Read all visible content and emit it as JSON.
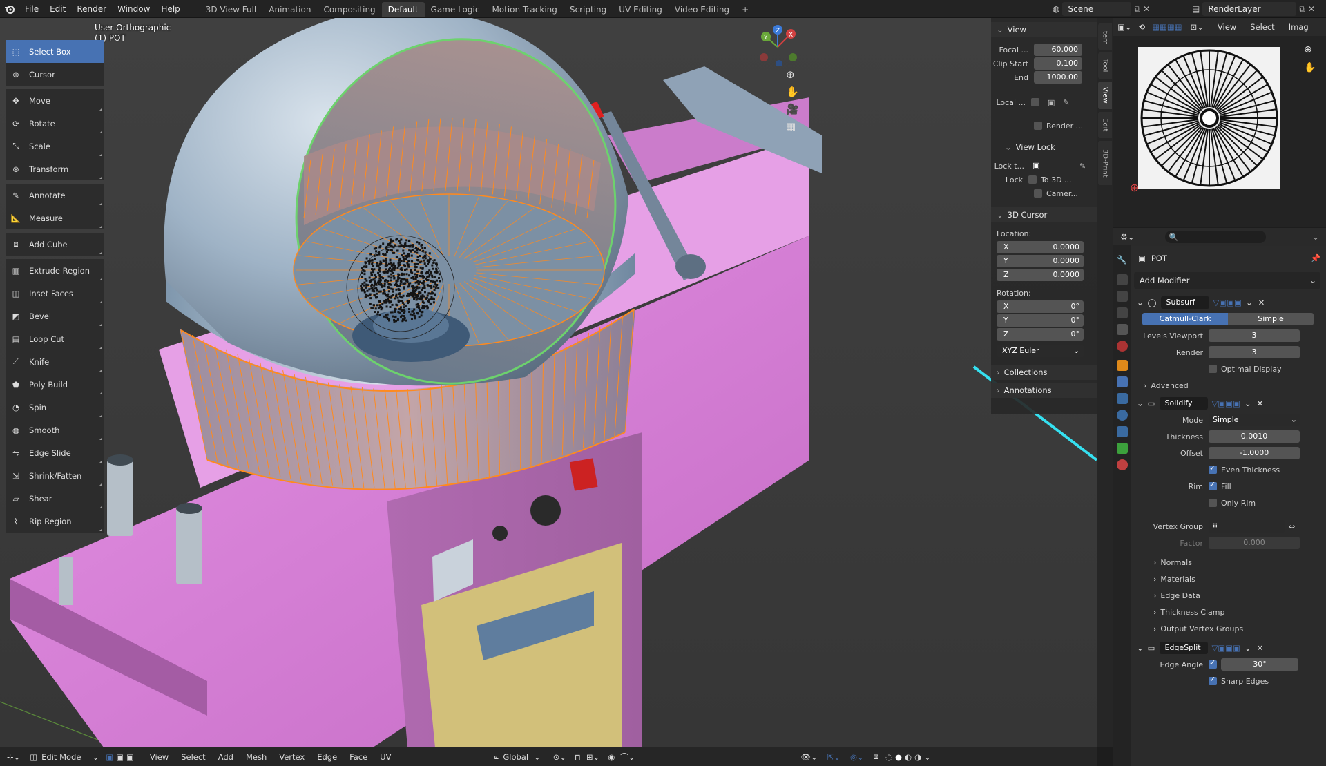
{
  "topbar": {
    "menus": [
      "File",
      "Edit",
      "Render",
      "Window",
      "Help"
    ],
    "workspaces": [
      "3D View Full",
      "Animation",
      "Compositing",
      "Default",
      "Game Logic",
      "Motion Tracking",
      "Scripting",
      "UV Editing",
      "Video Editing"
    ],
    "active_workspace": "Default",
    "add_tab": "+",
    "scene": "Scene",
    "view_layer": "RenderLayer"
  },
  "viewport": {
    "view_name": "User Orthographic",
    "object_name": "(1) POT"
  },
  "toolbar": [
    {
      "label": "Select Box",
      "icon": "select-box-icon",
      "active": true
    },
    {
      "label": "Cursor",
      "icon": "cursor-icon"
    },
    {
      "label": "Move",
      "icon": "move-icon"
    },
    {
      "label": "Rotate",
      "icon": "rotate-icon"
    },
    {
      "label": "Scale",
      "icon": "scale-icon"
    },
    {
      "label": "Transform",
      "icon": "transform-icon"
    },
    {
      "label": "Annotate",
      "icon": "annotate-icon"
    },
    {
      "label": "Measure",
      "icon": "measure-icon"
    },
    {
      "label": "Add Cube",
      "icon": "add-cube-icon"
    },
    {
      "label": "Extrude Region",
      "icon": "extrude-icon"
    },
    {
      "label": "Inset Faces",
      "icon": "inset-icon"
    },
    {
      "label": "Bevel",
      "icon": "bevel-icon"
    },
    {
      "label": "Loop Cut",
      "icon": "loop-cut-icon"
    },
    {
      "label": "Knife",
      "icon": "knife-icon"
    },
    {
      "label": "Poly Build",
      "icon": "poly-build-icon"
    },
    {
      "label": "Spin",
      "icon": "spin-icon"
    },
    {
      "label": "Smooth",
      "icon": "smooth-icon"
    },
    {
      "label": "Edge Slide",
      "icon": "edge-slide-icon"
    },
    {
      "label": "Shrink/Fatten",
      "icon": "shrink-fatten-icon"
    },
    {
      "label": "Shear",
      "icon": "shear-icon"
    },
    {
      "label": "Rip Region",
      "icon": "rip-icon"
    }
  ],
  "npanel": {
    "view_header": "View",
    "focal_label": "Focal ...",
    "focal_value": "60.000",
    "clip_start_label": "Clip Start",
    "clip_start_value": "0.100",
    "clip_end_label": "End",
    "clip_end_value": "1000.00",
    "local_label": "Local ...",
    "render_label": "Render ...",
    "view_lock_header": "View Lock",
    "lock_to_label": "Lock t...",
    "lock_label": "Lock",
    "to_3d_label": "To 3D ...",
    "camera_label": "Camer...",
    "cursor_header": "3D Cursor",
    "location_label": "Location:",
    "loc_x_label": "X",
    "loc_x": "0.0000",
    "loc_y_label": "Y",
    "loc_y": "0.0000",
    "loc_z_label": "Z",
    "loc_z": "0.0000",
    "rotation_label": "Rotation:",
    "rot_x_label": "X",
    "rot_x": "0°",
    "rot_y_label": "Y",
    "rot_y": "0°",
    "rot_z_label": "Z",
    "rot_z": "0°",
    "rotation_mode": "XYZ Euler",
    "collections": "Collections",
    "annotations": "Annotations"
  },
  "sidetabs": [
    "Item",
    "Tool",
    "View",
    "Edit",
    "3D-Print"
  ],
  "image_editor": {
    "view": "View",
    "select": "Select",
    "image": "Imag"
  },
  "properties": {
    "search_placeholder": "",
    "object_name": "POT",
    "add_modifier": "Add Modifier",
    "subsurf": {
      "name": "Subsurf",
      "catmull": "Catmull-Clark",
      "simple": "Simple",
      "levels_viewport_label": "Levels Viewport",
      "levels_viewport": "3",
      "render_label": "Render",
      "render": "3",
      "optimal_display": "Optimal Display",
      "advanced": "Advanced"
    },
    "solidify": {
      "name": "Solidify",
      "mode_label": "Mode",
      "mode": "Simple",
      "thickness_label": "Thickness",
      "thickness": "0.0010",
      "offset_label": "Offset",
      "offset": "-1.0000",
      "even_thickness": "Even Thickness",
      "rim_label": "Rim",
      "fill": "Fill",
      "only_rim": "Only Rim",
      "vertex_group_label": "Vertex Group",
      "factor_label": "Factor",
      "factor": "0.000",
      "normals": "Normals",
      "materials": "Materials",
      "edge_data": "Edge Data",
      "thickness_clamp": "Thickness Clamp",
      "output_vertex_groups": "Output Vertex Groups"
    },
    "edgesplit": {
      "name": "EdgeSplit",
      "edge_angle_label": "Edge Angle",
      "edge_angle": "30°",
      "sharp_edges": "Sharp Edges"
    }
  },
  "bottombar": {
    "mode": "Edit Mode",
    "menus": [
      "View",
      "Select",
      "Add",
      "Mesh",
      "Vertex",
      "Edge",
      "Face",
      "UV"
    ],
    "orientation": "Global"
  },
  "colors": {
    "accent": "#4772b3",
    "table_pink": "#d47ad4",
    "selection_orange": "#ff8a1e",
    "dome_blue": "#8fa6bd"
  }
}
